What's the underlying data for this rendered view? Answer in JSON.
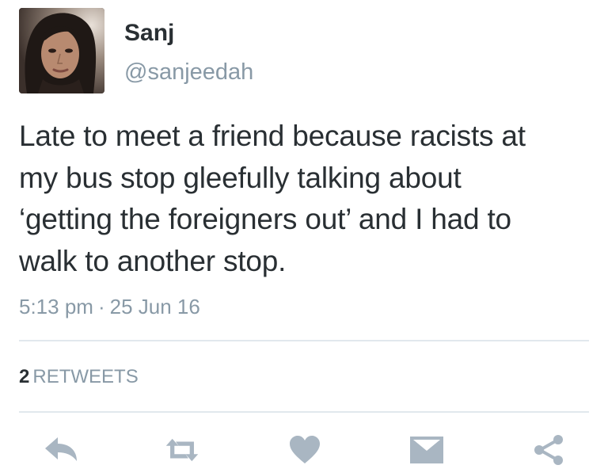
{
  "tweet": {
    "author_name": "Sanj",
    "author_handle": "@sanjeedah",
    "text_lines": [
      "Late to meet a friend because racists at",
      "my bus stop gleefully talking about",
      "‘getting the foreigners out’ and I had to",
      "walk to another stop."
    ],
    "time": "5:13 pm",
    "separator": "·",
    "date": "25 Jun 16",
    "retweet_count": "2",
    "retweet_label": "RETWEETS"
  },
  "actions": [
    {
      "name": "reply",
      "icon": "reply-icon"
    },
    {
      "name": "retweet",
      "icon": "retweet-icon"
    },
    {
      "name": "like",
      "icon": "heart-icon"
    },
    {
      "name": "direct-message",
      "icon": "envelope-icon"
    },
    {
      "name": "share",
      "icon": "share-icon"
    }
  ],
  "colors": {
    "text": "#292f33",
    "secondary": "#8899a6",
    "icon": "#a9b6c2",
    "divider": "#e1e8ed"
  }
}
